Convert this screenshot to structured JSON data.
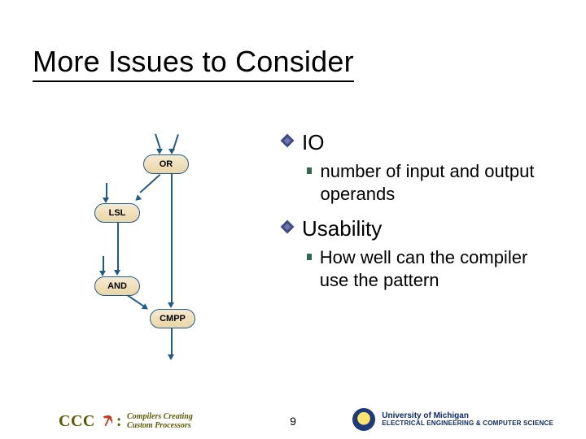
{
  "title": "More Issues to Consider",
  "diagram": {
    "nodes": {
      "or": "OR",
      "lsl": "LSL",
      "and": "AND",
      "cmpp": "CMPP"
    }
  },
  "bullets": {
    "io": {
      "label": "IO",
      "sub1": "number of input and output operands"
    },
    "usability": {
      "label": "Usability",
      "sub1": "How well can the compiler use the pattern"
    }
  },
  "footer": {
    "page_num": "9",
    "left": {
      "ccc": "CCC",
      "colon": ":",
      "tagline_line1": "Compilers Creating",
      "tagline_line2": "Custom Processors"
    },
    "right": {
      "line1": "University of Michigan",
      "line2": "ELECTRICAL ENGINEERING & COMPUTER SCIENCE"
    }
  }
}
